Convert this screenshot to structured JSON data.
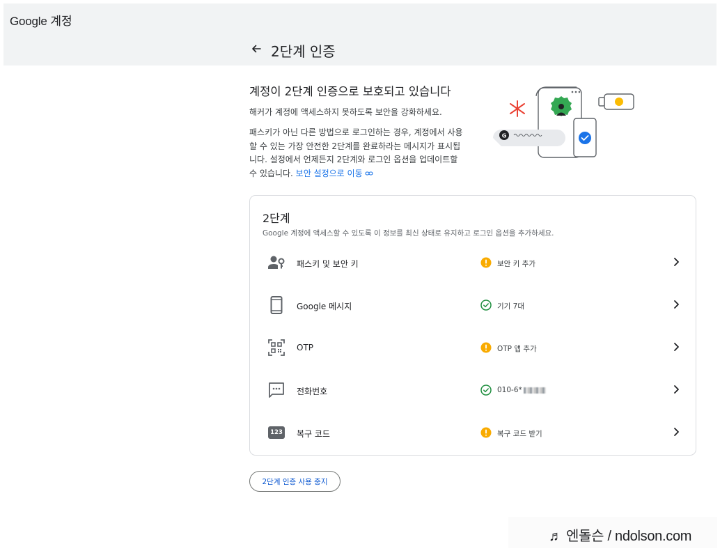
{
  "header": {
    "brand_google": "Google",
    "brand_account": "계정"
  },
  "page": {
    "title": "2단계 인증"
  },
  "hero": {
    "title": "계정이 2단계 인증으로 보호되고 있습니다",
    "subtitle": "해커가 계정에 액세스하지 못하도록 보안을 강화하세요.",
    "description": "패스키가 아닌 다른 방법으로 로그인하는 경우, 계정에서 사용할 수 있는 가장 안전한 2단계를 완료하라는 메시지가 표시됩니다. 설정에서 언제든지 2단계와 로그인 옵션을 업데이트할 수 있습니다.",
    "link": "보안 설정으로 이동"
  },
  "card": {
    "title": "2단계",
    "subtitle": "Google 계정에 액세스할 수 있도록 이 정보를 최신 상태로 유지하고 로그인 옵션을 추가하세요.",
    "rows": [
      {
        "label": "패스키 및 보안 키",
        "icon": "passkey-icon",
        "status": "보안 키 추가",
        "status_type": "warning"
      },
      {
        "label": "Google 메시지",
        "icon": "phone-icon",
        "status": "기기 7대",
        "status_type": "ok"
      },
      {
        "label": "OTP",
        "icon": "qr-code-icon",
        "status": "OTP 앱 추가",
        "status_type": "warning"
      },
      {
        "label": "전화번호",
        "icon": "message-icon",
        "status": "010-6*",
        "status_type": "ok"
      },
      {
        "label": "복구 코드",
        "icon": "recovery-code-icon",
        "icon_text": "123",
        "status": "복구 코드 받기",
        "status_type": "warning"
      }
    ]
  },
  "actions": {
    "disable_label": "2단계 인증 사용 중지"
  },
  "watermark": {
    "text": "♬ 엔돌슨 / ndolson.com"
  },
  "colors": {
    "warning": "#f9ab00",
    "ok": "#1e8e3e",
    "link": "#1a73e8",
    "icon": "#5f6368"
  }
}
